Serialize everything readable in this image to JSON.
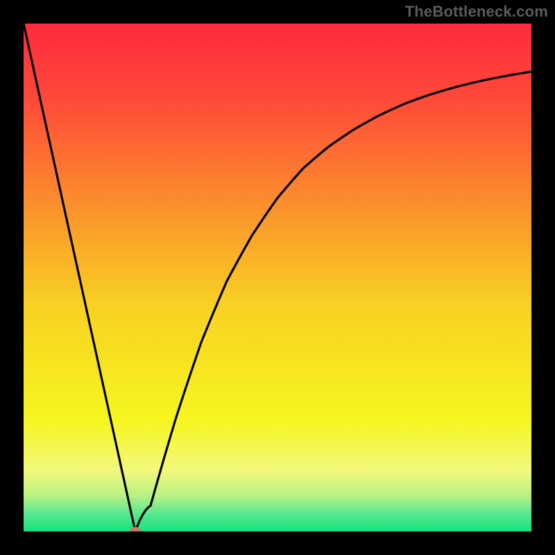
{
  "watermark": "TheBottleneck.com",
  "chart_data": {
    "type": "line",
    "x": [
      0,
      5,
      10,
      15,
      20,
      25,
      30,
      35,
      40,
      45,
      50,
      55,
      60,
      65,
      70,
      75,
      80,
      85,
      90,
      95,
      100
    ],
    "values": [
      100,
      78,
      55,
      33,
      10,
      0,
      20,
      38,
      52,
      62,
      70,
      76,
      80,
      83,
      85.5,
      87.5,
      89,
      90.2,
      91.2,
      92,
      92.7
    ],
    "title": "",
    "xlabel": "",
    "ylabel": "",
    "xlim": [
      0,
      100
    ],
    "ylim": [
      0,
      100
    ],
    "minimum_x": 22,
    "marker": {
      "x": 22,
      "y": 0,
      "color": "#c47a6a"
    },
    "gradient_stops": [
      {
        "offset": 0.0,
        "color": "#ff2a3e"
      },
      {
        "offset": 0.15,
        "color": "#fe4a38"
      },
      {
        "offset": 0.35,
        "color": "#fb8d2d"
      },
      {
        "offset": 0.55,
        "color": "#f8d023"
      },
      {
        "offset": 0.78,
        "color": "#f6f61e"
      },
      {
        "offset": 0.88,
        "color": "#f2f87c"
      },
      {
        "offset": 0.93,
        "color": "#b8f284"
      },
      {
        "offset": 0.965,
        "color": "#58e890"
      },
      {
        "offset": 1.0,
        "color": "#14e27c"
      }
    ]
  }
}
